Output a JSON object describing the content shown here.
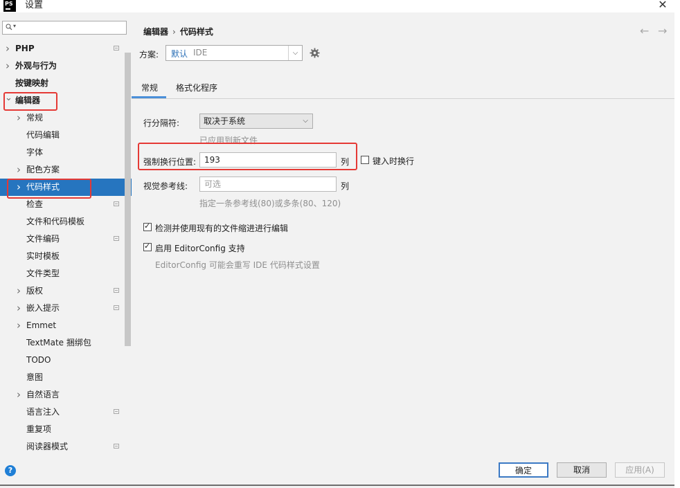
{
  "window": {
    "title": "设置",
    "app_logo": "PS"
  },
  "sidebar": {
    "search_placeholder": "",
    "items": [
      {
        "label": "PHP",
        "bold": true,
        "expand": "right",
        "level": 0,
        "project_icon": true
      },
      {
        "label": "外观与行为",
        "bold": true,
        "expand": "right",
        "level": 0,
        "project_icon": false
      },
      {
        "label": "按键映射",
        "bold": true,
        "expand": "none",
        "level": 0,
        "project_icon": false
      },
      {
        "label": "编辑器",
        "bold": true,
        "expand": "down",
        "level": 0,
        "project_icon": false
      },
      {
        "label": "常规",
        "bold": false,
        "expand": "right",
        "level": 1,
        "project_icon": false
      },
      {
        "label": "代码编辑",
        "bold": false,
        "expand": "none",
        "level": 1,
        "project_icon": false
      },
      {
        "label": "字体",
        "bold": false,
        "expand": "none",
        "level": 1,
        "project_icon": false
      },
      {
        "label": "配色方案",
        "bold": false,
        "expand": "right",
        "level": 1,
        "project_icon": false
      },
      {
        "label": "代码样式",
        "bold": false,
        "expand": "right",
        "level": 1,
        "project_icon": false,
        "selected": true
      },
      {
        "label": "检查",
        "bold": false,
        "expand": "none",
        "level": 1,
        "project_icon": true
      },
      {
        "label": "文件和代码模板",
        "bold": false,
        "expand": "none",
        "level": 1,
        "project_icon": false
      },
      {
        "label": "文件编码",
        "bold": false,
        "expand": "none",
        "level": 1,
        "project_icon": true
      },
      {
        "label": "实时模板",
        "bold": false,
        "expand": "none",
        "level": 1,
        "project_icon": false
      },
      {
        "label": "文件类型",
        "bold": false,
        "expand": "none",
        "level": 1,
        "project_icon": false
      },
      {
        "label": "版权",
        "bold": false,
        "expand": "right",
        "level": 1,
        "project_icon": true
      },
      {
        "label": "嵌入提示",
        "bold": false,
        "expand": "right",
        "level": 1,
        "project_icon": true
      },
      {
        "label": "Emmet",
        "bold": false,
        "expand": "right",
        "level": 1,
        "project_icon": false
      },
      {
        "label": "TextMate 捆绑包",
        "bold": false,
        "expand": "none",
        "level": 1,
        "project_icon": false
      },
      {
        "label": "TODO",
        "bold": false,
        "expand": "none",
        "level": 1,
        "project_icon": false
      },
      {
        "label": "意图",
        "bold": false,
        "expand": "none",
        "level": 1,
        "project_icon": false
      },
      {
        "label": "自然语言",
        "bold": false,
        "expand": "right",
        "level": 1,
        "project_icon": false
      },
      {
        "label": "语言注入",
        "bold": false,
        "expand": "none",
        "level": 1,
        "project_icon": true
      },
      {
        "label": "重复项",
        "bold": false,
        "expand": "none",
        "level": 1,
        "project_icon": false
      },
      {
        "label": "阅读器模式",
        "bold": false,
        "expand": "none",
        "level": 1,
        "project_icon": true
      }
    ]
  },
  "main": {
    "breadcrumb": [
      "编辑器",
      "代码样式"
    ],
    "breadcrumb_sep": "›",
    "nav_back": "←",
    "nav_forward": "→",
    "scheme_label": "方案:",
    "scheme_value": "默认",
    "scheme_badge": "IDE",
    "tabs": [
      {
        "label": "常规",
        "active": true
      },
      {
        "label": "格式化程序",
        "active": false
      }
    ],
    "line_separator_label": "行分隔符:",
    "line_separator_value": "取决于系统",
    "line_separator_hint": "已应用到新文件",
    "hard_wrap_label": "强制换行位置:",
    "hard_wrap_value": "193",
    "hard_wrap_unit": "列",
    "wrap_on_typing_label": "键入时换行",
    "wrap_on_typing_checked": false,
    "visual_guides_label": "视觉参考线:",
    "visual_guides_placeholder": "可选",
    "visual_guides_unit": "列",
    "visual_guides_hint": "指定一条参考线(80)或多条(80、120)",
    "detect_indent_label": "检测并使用现有的文件缩进进行编辑",
    "detect_indent_checked": true,
    "editorconfig_label": "启用 EditorConfig 支持",
    "editorconfig_checked": true,
    "editorconfig_hint": "EditorConfig 可能会重写 IDE 代码样式设置"
  },
  "footer": {
    "ok": "确定",
    "cancel": "取消",
    "apply": "应用(A)",
    "help": "?"
  },
  "colors": {
    "selection": "#2675bf",
    "highlight_box": "#e53935",
    "accent": "#4a8fd9"
  }
}
